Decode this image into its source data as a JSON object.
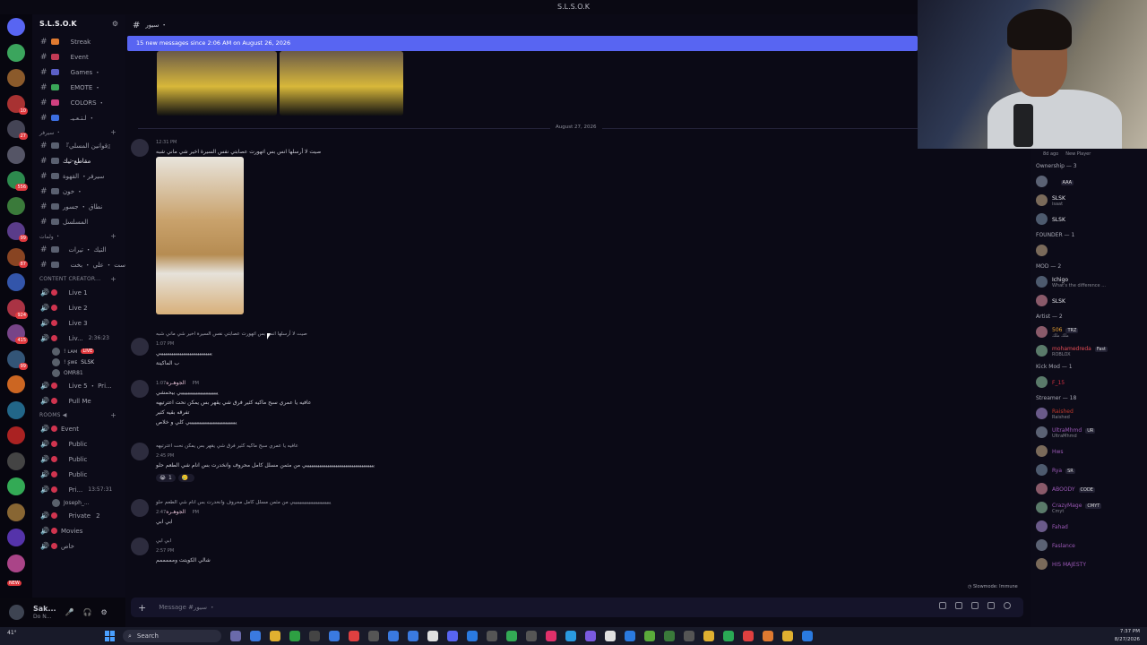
{
  "window": {
    "title": "S.L.S.O.K"
  },
  "server_rail": {
    "items": [
      {
        "color": "#5865f2"
      },
      {
        "color": "#3ba55d"
      },
      {
        "color": "#8b5a2b"
      },
      {
        "color": "#a83232",
        "badge": "10"
      },
      {
        "color": "#444455",
        "badge": "27"
      },
      {
        "color": "#555566"
      },
      {
        "color": "#2d8a4e",
        "badge": "556"
      },
      {
        "color": "#3a7a3a"
      },
      {
        "color": "#5a3c8a",
        "badge": "99"
      },
      {
        "color": "#884422",
        "badge": "87"
      },
      {
        "color": "#3355aa"
      },
      {
        "color": "#aa3344",
        "badge": "924"
      },
      {
        "color": "#774488",
        "badge": "415"
      },
      {
        "color": "#335577",
        "badge": "99"
      },
      {
        "color": "#cc6622"
      },
      {
        "color": "#226688"
      },
      {
        "color": "#aa2222"
      },
      {
        "color": "#444444"
      },
      {
        "color": "#33aa55"
      },
      {
        "color": "#886633"
      },
      {
        "color": "#5533aa"
      },
      {
        "color": "#aa4488"
      }
    ],
    "new_label": "NEW"
  },
  "server": {
    "name": "S.L.S.O.K"
  },
  "channels": {
    "text": [
      {
        "label": "ﾠ Streak",
        "color": "#e07a30"
      },
      {
        "label": "ﾠ Event",
        "color": "#c23a55"
      },
      {
        "label": "ﾠ Games ・",
        "color": "#5b5fc7"
      },
      {
        "label": "ﾠ EMOTE ・",
        "color": "#3aa558"
      },
      {
        "label": "ﾠ COLORS ・",
        "color": "#d04080"
      },
      {
        "label": "ﾠ لـتـعـيـ ・",
        "color": "#3c6ee0"
      }
    ],
    "category_1": "سيرفر ・",
    "group_1": [
      {
        "label": "『قوانين المسلي』",
        "active": false
      },
      {
        "label": "مقاطع-تيك",
        "active": true
      },
      {
        "label": "سيرفر・ القهوة",
        "active": false
      },
      {
        "label": "خون ・",
        "active": false
      },
      {
        "label": "نطاق ・ جسور",
        "active": false
      },
      {
        "label": "المسلسل",
        "active": false
      }
    ],
    "category_2": "ولمات ・",
    "group_2": [
      {
        "label": "ﾠالتيك ・ تيرات"
      },
      {
        "label": "ﾠ ست ・ علي ・ بخت"
      }
    ],
    "category_3": "CONTENT CREATOR...",
    "voice_1": [
      {
        "label": "ﾠ Live 1"
      },
      {
        "label": "ﾠ Live 2"
      },
      {
        "label": "ﾠ Live 3"
      },
      {
        "label": "ﾠ Liv...",
        "time": "2:36:23"
      }
    ],
    "voice_users_1": [
      {
        "name": "! ʟᴀᴍ",
        "live": "LIVE"
      },
      {
        "name": "! ʂᴡᴇ",
        "tag": "SLSK"
      },
      {
        "name": "OMR81"
      }
    ],
    "voice_2": [
      {
        "label": "ﾠ Live 5 ・ Pri..."
      },
      {
        "label": "ﾠ Pull Me"
      }
    ],
    "category_4": "ROOMS ◀",
    "rooms": [
      {
        "label": "Event"
      },
      {
        "label": "ﾠ Public"
      },
      {
        "label": "ﾠ Public"
      },
      {
        "label": "ﾠ Public"
      },
      {
        "label": "ﾠ Pri...",
        "time": "13:57:31"
      }
    ],
    "room_user": "Joseph_...",
    "voice_3": [
      {
        "label": "ﾠ Private",
        "count": "2"
      },
      {
        "label": "Movies"
      },
      {
        "label": "خاص"
      }
    ]
  },
  "user": {
    "name": "Sak...",
    "status": "Do N..."
  },
  "chat": {
    "channel_name": "سيور ・",
    "new_messages_banner": "15 new messages since 2:06 AM on August 26, 2026",
    "date_divider": "August 27, 2026",
    "messages": [
      {
        "time": "12:31 PM",
        "text": "صيت لا أرسلها انس بس اتهورت عصابتي نفس السيرة اخير شي ماني شبه",
        "name": ""
      },
      {
        "reply": "صيت لا أرسلها انس بس اتهورت عصابتي نفس السيرة اخير شي ماني شبه",
        "time": "1:07 PM",
        "lines": [
          "ييييييييييييييييييييييييييييييييي",
          "ب الماكينة"
        ]
      },
      {
        "name": "الجوهـره",
        "time": "1:07 PM",
        "lines": [
          "يييييييييييييييييييييييي بيحمشي",
          "عافيه يا عمري سبح ماكيه كثير فرق شي يقهر بس يمكن نحت اعترتيهه",
          "تفرقه بقيه كثير",
          "يييييييييييييييييييييييييييييي كلي و خلاص"
        ]
      },
      {
        "reply": "عافيه يا عمري سبح ماكيه كثير فرق شي يقهر بس يمكن نحت اعترتيهه",
        "time": "2:45 PM",
        "lines": [
          "ييييييييييييييييييييييييييييييييييييييييييي من مثمن مسلل كامل محروف وانخدرت بس انام شي الطعم حلو"
        ],
        "reactions": [
          {
            "emoji": "😭",
            "count": "1"
          },
          {
            "emoji": "🥲",
            "count": ""
          }
        ]
      },
      {
        "reply": "يييييييييييييييييييييييييي من مثمن مسلل كامل محروف وانخدرت بس انام شي الطعم حلو",
        "name": "الجوهـره",
        "time": "2:47 PM",
        "lines": [
          "ابي ابي"
        ]
      },
      {
        "reply": "ابي ابي",
        "time": "2:57 PM",
        "lines": [
          "شالي الكويتت ومممممم"
        ]
      }
    ],
    "composer_placeholder": "Message #سيور ・",
    "slowmode": "Slowmode: Immune"
  },
  "members": {
    "game_labels": [
      "8d ago",
      "New Player"
    ],
    "roles": [
      {
        "title": "Ownership — 3",
        "members": [
          {
            "name": "ﾠ",
            "tag": "AAA",
            "color": "#e8e8ee"
          },
          {
            "name": "SLSK",
            "sub": "isaat",
            "color": "#e8e8ee"
          },
          {
            "name": "SLSK",
            "color": "#e8e8ee"
          }
        ]
      },
      {
        "title": "FOUNDER — 1",
        "members": [
          {
            "name": "ﾠ",
            "color": "#e8e8ee"
          }
        ]
      },
      {
        "title": "MOD — 2",
        "members": [
          {
            "name": "Ichigo",
            "sub": "What's the difference ...",
            "color": "#e8e8ee"
          },
          {
            "name": "SLSK",
            "color": "#e8e8ee"
          }
        ]
      },
      {
        "title": "Artist — 2",
        "members": [
          {
            "name": "506",
            "tag": "TRZ",
            "sub": "ملك ملك",
            "color": "#e8a030"
          },
          {
            "name": "mohamedreda",
            "tag": "Fast",
            "sub": "ROBLOX",
            "color": "#e74c55"
          }
        ]
      },
      {
        "title": "Kick Mod — 1",
        "members": [
          {
            "name": "F_15",
            "color": "#d03040"
          }
        ]
      },
      {
        "title": "Streamer — 18",
        "members": [
          {
            "name": "Raished",
            "sub": "Raished",
            "color": "#c0392b"
          },
          {
            "name": "UltraMhmd",
            "tag": "UR",
            "sub": "UltraMhmd",
            "color": "#9b59b6"
          },
          {
            "name": "Hws",
            "color": "#9b59b6"
          },
          {
            "name": "Rya",
            "tag": "SR",
            "color": "#9b59b6"
          },
          {
            "name": "ABOODY",
            "tag": "CODE",
            "color": "#9b59b6"
          },
          {
            "name": "CrazyMage",
            "tag": "CMYT",
            "sub": "Cmyt",
            "color": "#9b59b6"
          },
          {
            "name": "Fahad",
            "color": "#9b59b6"
          },
          {
            "name": "Faslance",
            "color": "#9b59b6"
          },
          {
            "name": "HIS MAJESTY",
            "color": "#9b59b6"
          }
        ]
      }
    ]
  },
  "taskbar": {
    "search_label": "Search",
    "time": "7:37 PM",
    "date": "8/27/2026",
    "weather": "41°",
    "icons": [
      {
        "color": "#6a6aaa"
      },
      {
        "color": "#3a7ae0"
      },
      {
        "color": "#e0b030"
      },
      {
        "color": "#2ea043"
      },
      {
        "color": "#444"
      },
      {
        "color": "#3a7ae0"
      },
      {
        "color": "#e04040"
      },
      {
        "color": "#555"
      },
      {
        "color": "#3a7ae0"
      },
      {
        "color": "#3a7ae0"
      },
      {
        "color": "#e0e0e0"
      },
      {
        "color": "#5865f2"
      },
      {
        "color": "#2a7ae0"
      },
      {
        "color": "#555"
      },
      {
        "color": "#33aa55"
      },
      {
        "color": "#555"
      },
      {
        "color": "#e0306a"
      },
      {
        "color": "#2a9ae0"
      },
      {
        "color": "#7a5ae0"
      },
      {
        "color": "#e0e0e0"
      },
      {
        "color": "#2a7ae0"
      },
      {
        "color": "#5aaa3a"
      },
      {
        "color": "#3a7a3a"
      },
      {
        "color": "#555"
      },
      {
        "color": "#e0b030"
      },
      {
        "color": "#2aaa55"
      },
      {
        "color": "#e04040"
      },
      {
        "color": "#e07a30"
      },
      {
        "color": "#e0b030"
      },
      {
        "color": "#2a7ae0"
      }
    ]
  },
  "colors": {
    "accent": "#5865f2",
    "bg": "#0b0a16",
    "panel": "#0c0b18"
  }
}
